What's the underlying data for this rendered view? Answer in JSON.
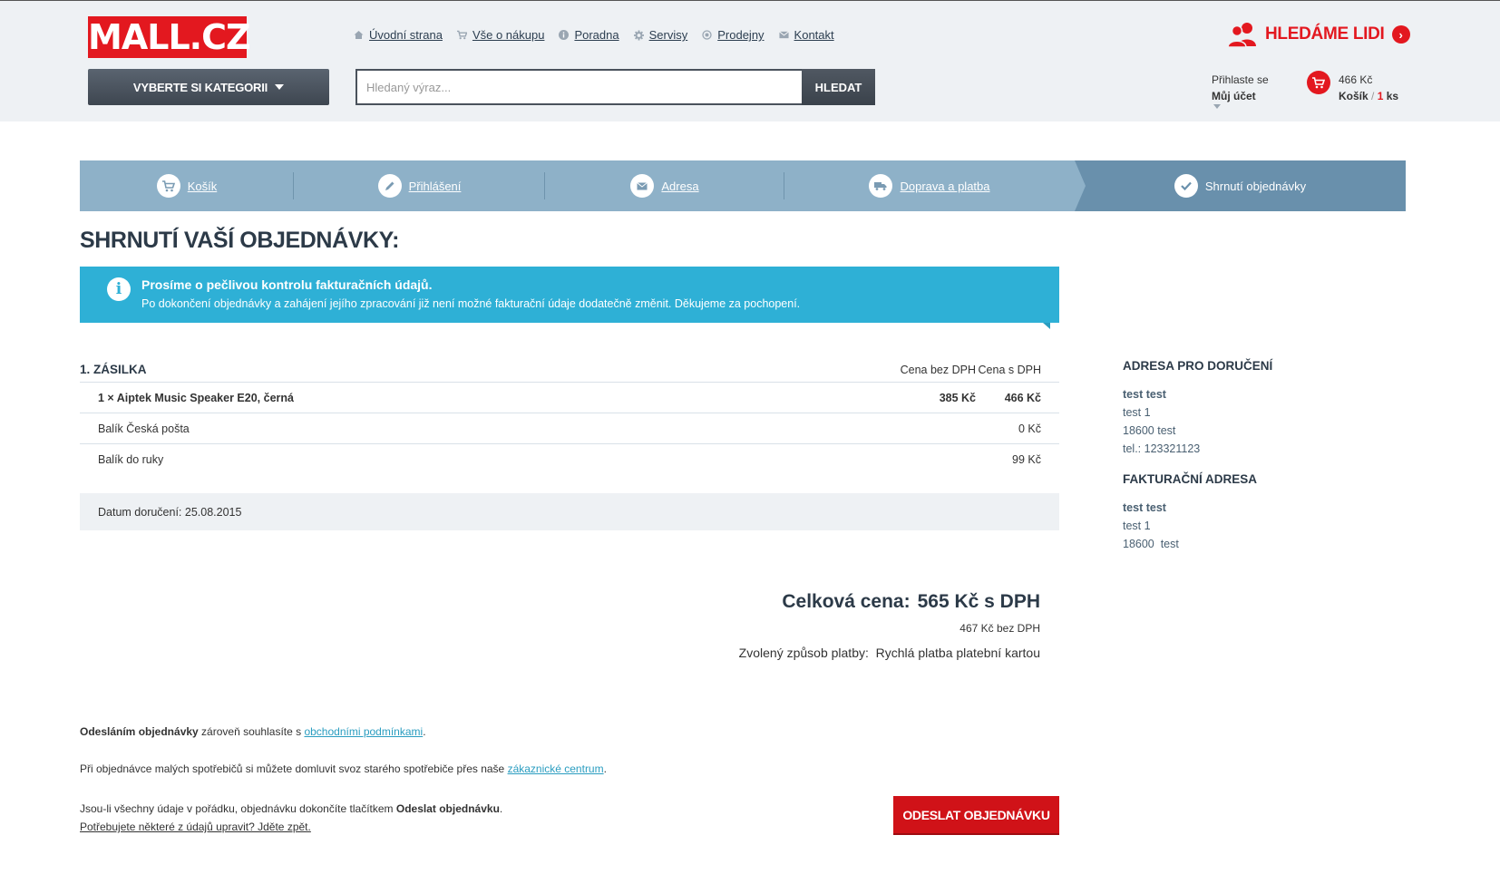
{
  "header": {
    "logo": "MALL.CZ",
    "nav": [
      {
        "label": "Úvodní strana",
        "icon": "home-icon"
      },
      {
        "label": "Vše o nákupu",
        "icon": "cart-icon"
      },
      {
        "label": "Poradna",
        "icon": "info-icon"
      },
      {
        "label": "Servisy",
        "icon": "gear-icon"
      },
      {
        "label": "Prodejny",
        "icon": "location-icon"
      },
      {
        "label": "Kontakt",
        "icon": "mail-icon"
      }
    ],
    "category_button": "VYBERTE SI KATEGORII",
    "search_placeholder": "Hledaný výraz...",
    "search_button": "HLEDAT",
    "jobs": "HLEDÁME LIDI",
    "login_line1": "Přihlaste se",
    "login_line2": "Můj účet",
    "cart_price": "466 Kč",
    "cart_label": "Košík",
    "cart_sep": "/",
    "cart_count": "1",
    "cart_unit": "ks"
  },
  "steps": [
    {
      "label": "Košík",
      "icon": "cart-icon"
    },
    {
      "label": "Přihlášení",
      "icon": "pencil-icon"
    },
    {
      "label": "Adresa",
      "icon": "envelope-icon"
    },
    {
      "label": "Doprava a platba",
      "icon": "truck-icon"
    },
    {
      "label": "Shrnutí objednávky",
      "icon": "check-icon",
      "active": true
    }
  ],
  "page_title": "SHRNUTÍ VAŠÍ OBJEDNÁVKY:",
  "notice": {
    "title": "Prosíme o pečlivou kontrolu fakturačních údajů.",
    "text": "Po dokončení objednávky a zahájení jejího zpracování již není možné fakturační údaje dodatečně změnit. Děkujeme za pochopení."
  },
  "shipment": {
    "title": "1. ZÁSILKA",
    "col_without_vat": "Cena bez DPH",
    "col_with_vat": "Cena s DPH",
    "rows": [
      {
        "name": "1 × Aiptek Music Speaker E20, černá",
        "price_without_vat": "385 Kč",
        "price_with_vat": "466 Kč"
      },
      {
        "name": "Balík Česká pošta",
        "price_without_vat": "",
        "price_with_vat": "0 Kč"
      },
      {
        "name": "Balík do ruky",
        "price_without_vat": "",
        "price_with_vat": "99 Kč"
      }
    ],
    "delivery_date": "Datum doručení: 25.08.2015"
  },
  "total": {
    "label": "Celková cena:",
    "value": "565 Kč s DPH",
    "without_vat": "467 Kč bez DPH",
    "payment_label": "Zvolený způsob platby:",
    "payment_value": "Rychlá platba platební kartou"
  },
  "delivery_address": {
    "title": "ADRESA PRO DORUČENÍ",
    "name": "test test",
    "street": "test 1",
    "city": "18600 test",
    "phone": "tel.: 123321123"
  },
  "billing_address": {
    "title": "FAKTURAČNÍ ADRESA",
    "name": "test test",
    "street": "test 1",
    "city": "18600  test"
  },
  "footer": {
    "terms_bold": "Odesláním objednávky",
    "terms_text": " zároveň souhlasíte s ",
    "terms_link": "obchodními podmínkami",
    "terms_end": ".",
    "recycle_text": "Při objednávce malých spotřebičů si můžete domluvit svoz starého spotřebiče přes naše ",
    "recycle_link": "zákaznické centrum",
    "recycle_end": ".",
    "finish_text": "Jsou-li všechny údaje v pořádku, objednávku dokončíte tlačítkem ",
    "finish_bold": "Odeslat objednávku",
    "finish_end": ".",
    "back_link": "Potřebujete některé z údajů upravit? Jděte zpět.",
    "submit": "ODESLAT OBJEDNÁVKU"
  },
  "colors": {
    "brand_red": "#e3181f",
    "notice_blue": "#2eb0d6",
    "steps_bg": "#8eb1c8",
    "steps_active": "#6990ac"
  }
}
